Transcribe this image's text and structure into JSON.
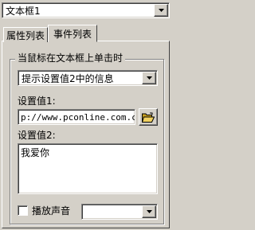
{
  "object_selector": {
    "value": "文本框1"
  },
  "tabs": [
    {
      "label": "属性列表",
      "active": false
    },
    {
      "label": "事件列表",
      "active": true
    }
  ],
  "event_group": {
    "legend": "当鼠标在文本框上单击时",
    "action_select": {
      "value": "提示设置值2中的信息"
    },
    "value1": {
      "label": "设置值1:",
      "value": "p://www.pconline.com.cn"
    },
    "value2": {
      "label": "设置值2:",
      "value": "我爱你"
    },
    "play_sound": {
      "label": "播放声音",
      "checked": false,
      "sound_select": ""
    }
  },
  "icons": {
    "dropdown": "chevron-down-icon",
    "browse": "folder-open-icon"
  }
}
